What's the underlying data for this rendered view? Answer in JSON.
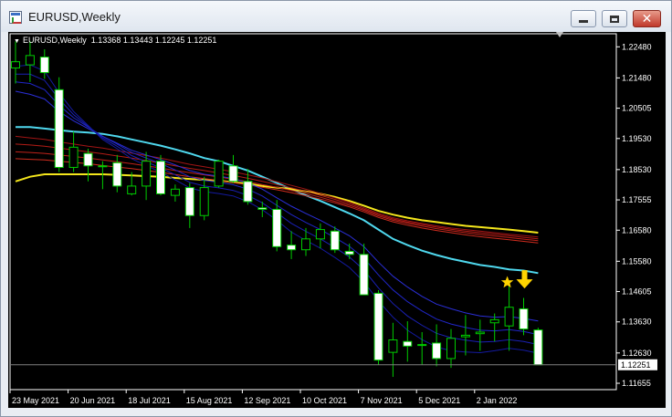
{
  "window": {
    "title": "EURUSD,Weekly",
    "minimize_icon": "minimize-icon",
    "maximize_icon": "maximize-icon",
    "close_icon": "close-icon"
  },
  "chart": {
    "symbol_line": "EURUSD,Weekly  1.13368 1.13443 1.12245 1.12251",
    "current_price_label": "1.12251",
    "colors": {
      "background": "#000000",
      "axis": "#ffffff",
      "bull": "#000000",
      "bear": "#ffffff",
      "wick": "#00cc00",
      "ema_blue": "#1e2bd6",
      "ema_red": "#c0221a",
      "ema_cyan": "#4fd8ee",
      "ema_yellow": "#f4e61c",
      "marker": "#ffd400"
    },
    "markers": [
      "star-icon",
      "arrow-down-icon"
    ]
  },
  "chart_data": {
    "type": "candlestick",
    "title": "EURUSD,Weekly",
    "ohlc_last": {
      "open": 1.13368,
      "high": 1.13443,
      "low": 1.12245,
      "close": 1.12251
    },
    "ylim": [
      1.1145,
      1.229
    ],
    "y_ticks": [
      "1.22480",
      "1.21480",
      "1.20505",
      "1.19530",
      "1.18530",
      "1.17555",
      "1.16580",
      "1.15580",
      "1.14605",
      "1.13630",
      "1.12630",
      "1.11655"
    ],
    "y_tick_values": [
      1.2248,
      1.2148,
      1.20505,
      1.1953,
      1.1853,
      1.17555,
      1.1658,
      1.1558,
      1.14605,
      1.1363,
      1.1263,
      1.11655
    ],
    "x_ticks": [
      "23 May 2021",
      "20 Jun 2021",
      "18 Jul 2021",
      "15 Aug 2021",
      "12 Sep 2021",
      "10 Oct 2021",
      "7 Nov 2021",
      "5 Dec 2021",
      "2 Jan 2022"
    ],
    "x_tick_index": [
      0,
      4,
      8,
      12,
      16,
      20,
      24,
      28,
      32
    ],
    "candles": [
      {
        "o": 1.218,
        "h": 1.2265,
        "l": 1.213,
        "c": 1.22
      },
      {
        "o": 1.219,
        "h": 1.2266,
        "l": 1.2135,
        "c": 1.222
      },
      {
        "o": 1.2215,
        "h": 1.224,
        "l": 1.2145,
        "c": 1.2165
      },
      {
        "o": 1.211,
        "h": 1.215,
        "l": 1.1845,
        "c": 1.186
      },
      {
        "o": 1.186,
        "h": 1.1975,
        "l": 1.1845,
        "c": 1.1925
      },
      {
        "o": 1.1905,
        "h": 1.192,
        "l": 1.1815,
        "c": 1.1865
      },
      {
        "o": 1.1865,
        "h": 1.188,
        "l": 1.179,
        "c": 1.1865
      },
      {
        "o": 1.1875,
        "h": 1.19,
        "l": 1.178,
        "c": 1.18
      },
      {
        "o": 1.1775,
        "h": 1.1845,
        "l": 1.177,
        "c": 1.18
      },
      {
        "o": 1.18,
        "h": 1.191,
        "l": 1.1755,
        "c": 1.188
      },
      {
        "o": 1.188,
        "h": 1.19,
        "l": 1.177,
        "c": 1.1775
      },
      {
        "o": 1.177,
        "h": 1.1805,
        "l": 1.175,
        "c": 1.179
      },
      {
        "o": 1.1795,
        "h": 1.181,
        "l": 1.1665,
        "c": 1.1705
      },
      {
        "o": 1.1705,
        "h": 1.183,
        "l": 1.169,
        "c": 1.1795
      },
      {
        "o": 1.18,
        "h": 1.1885,
        "l": 1.1795,
        "c": 1.188
      },
      {
        "o": 1.1865,
        "h": 1.19,
        "l": 1.181,
        "c": 1.1815
      },
      {
        "o": 1.1815,
        "h": 1.1855,
        "l": 1.174,
        "c": 1.175
      },
      {
        "o": 1.173,
        "h": 1.175,
        "l": 1.17,
        "c": 1.1725
      },
      {
        "o": 1.1725,
        "h": 1.1755,
        "l": 1.159,
        "c": 1.1605
      },
      {
        "o": 1.161,
        "h": 1.1655,
        "l": 1.1565,
        "c": 1.1595
      },
      {
        "o": 1.1595,
        "h": 1.1665,
        "l": 1.1575,
        "c": 1.163
      },
      {
        "o": 1.163,
        "h": 1.168,
        "l": 1.16,
        "c": 1.166
      },
      {
        "o": 1.1655,
        "h": 1.167,
        "l": 1.1585,
        "c": 1.1595
      },
      {
        "o": 1.159,
        "h": 1.1615,
        "l": 1.1565,
        "c": 1.158
      },
      {
        "o": 1.158,
        "h": 1.1615,
        "l": 1.145,
        "c": 1.145
      },
      {
        "o": 1.1455,
        "h": 1.1465,
        "l": 1.1225,
        "c": 1.124
      },
      {
        "o": 1.1265,
        "h": 1.136,
        "l": 1.1186,
        "c": 1.1305
      },
      {
        "o": 1.13,
        "h": 1.1365,
        "l": 1.1235,
        "c": 1.1285
      },
      {
        "o": 1.129,
        "h": 1.133,
        "l": 1.1225,
        "c": 1.129
      },
      {
        "o": 1.1295,
        "h": 1.1355,
        "l": 1.122,
        "c": 1.1245
      },
      {
        "o": 1.1245,
        "h": 1.134,
        "l": 1.1215,
        "c": 1.131
      },
      {
        "o": 1.1315,
        "h": 1.1385,
        "l": 1.1255,
        "c": 1.132
      },
      {
        "o": 1.1325,
        "h": 1.137,
        "l": 1.127,
        "c": 1.133
      },
      {
        "o": 1.136,
        "h": 1.139,
        "l": 1.13,
        "c": 1.137
      },
      {
        "o": 1.135,
        "h": 1.148,
        "l": 1.127,
        "c": 1.141
      },
      {
        "o": 1.1405,
        "h": 1.144,
        "l": 1.132,
        "c": 1.134
      },
      {
        "o": 1.1337,
        "h": 1.1344,
        "l": 1.1225,
        "c": 1.1225
      }
    ],
    "ema_lines": [
      {
        "color": "#4fd8ee",
        "width": 2,
        "values": [
          1.199,
          1.199,
          1.1985,
          1.198,
          1.1975,
          1.1972,
          1.1968,
          1.196,
          1.195,
          1.194,
          1.193,
          1.1918,
          1.1905,
          1.189,
          1.188,
          1.1865,
          1.185,
          1.183,
          1.181,
          1.179,
          1.177,
          1.1752,
          1.1732,
          1.1712,
          1.169,
          1.166,
          1.163,
          1.161,
          1.1592,
          1.1578,
          1.1566,
          1.1556,
          1.1546,
          1.154,
          1.1532,
          1.1528,
          1.152
        ]
      },
      {
        "color": "#f4e61c",
        "width": 2,
        "values": [
          1.1815,
          1.183,
          1.1838,
          1.1838,
          1.1838,
          1.1838,
          1.1838,
          1.1836,
          1.1834,
          1.1832,
          1.183,
          1.1826,
          1.1823,
          1.182,
          1.1818,
          1.1812,
          1.1808,
          1.18,
          1.1795,
          1.179,
          1.1783,
          1.1775,
          1.1765,
          1.1752,
          1.1737,
          1.172,
          1.1708,
          1.1698,
          1.169,
          1.1684,
          1.1678,
          1.1672,
          1.1668,
          1.1664,
          1.166,
          1.1655,
          1.165
        ]
      },
      {
        "color": "#a31515",
        "width": 1,
        "values": [
          1.196,
          1.1955,
          1.195,
          1.1942,
          1.1935,
          1.1928,
          1.1922,
          1.1914,
          1.1906,
          1.1898,
          1.189,
          1.188,
          1.187,
          1.1862,
          1.1854,
          1.1846,
          1.1836,
          1.1826,
          1.1814,
          1.1802,
          1.179,
          1.1776,
          1.1762,
          1.1748,
          1.173,
          1.1712,
          1.1698,
          1.1688,
          1.168,
          1.1672,
          1.1665,
          1.166,
          1.1655,
          1.165,
          1.1645,
          1.1641,
          1.1636
        ]
      },
      {
        "color": "#b41c16",
        "width": 1,
        "values": [
          1.1935,
          1.1932,
          1.1928,
          1.1922,
          1.1916,
          1.191,
          1.1904,
          1.1897,
          1.189,
          1.1882,
          1.1874,
          1.1865,
          1.1857,
          1.185,
          1.1842,
          1.1834,
          1.1825,
          1.1815,
          1.1805,
          1.1794,
          1.1783,
          1.177,
          1.1757,
          1.1743,
          1.1726,
          1.1708,
          1.1694,
          1.1684,
          1.1676,
          1.1668,
          1.1661,
          1.1655,
          1.165,
          1.1645,
          1.164,
          1.1635,
          1.163
        ]
      },
      {
        "color": "#c0221a",
        "width": 1,
        "values": [
          1.191,
          1.1908,
          1.1905,
          1.19,
          1.1895,
          1.189,
          1.1884,
          1.1878,
          1.1872,
          1.1865,
          1.1858,
          1.185,
          1.1843,
          1.1836,
          1.1829,
          1.1822,
          1.1814,
          1.1805,
          1.1796,
          1.1786,
          1.1776,
          1.1764,
          1.1751,
          1.1738,
          1.1722,
          1.1704,
          1.169,
          1.168,
          1.1671,
          1.1663,
          1.1656,
          1.165,
          1.1644,
          1.1639,
          1.1634,
          1.1629,
          1.1624
        ]
      },
      {
        "color": "#d02c1e",
        "width": 1,
        "values": [
          1.1888,
          1.1886,
          1.1884,
          1.188,
          1.1876,
          1.1872,
          1.1866,
          1.1861,
          1.1856,
          1.185,
          1.1844,
          1.1837,
          1.183,
          1.1824,
          1.1818,
          1.1811,
          1.1804,
          1.1796,
          1.1788,
          1.1779,
          1.1769,
          1.1758,
          1.1746,
          1.1733,
          1.1717,
          1.1699,
          1.1685,
          1.1674,
          1.1665,
          1.1657,
          1.165,
          1.1643,
          1.1637,
          1.1632,
          1.1627,
          1.1622,
          1.1617
        ]
      },
      {
        "color": "#2b2fd8",
        "width": 1,
        "values": [
          1.2105,
          1.2095,
          1.208,
          1.204,
          1.201,
          1.1985,
          1.196,
          1.1938,
          1.1915,
          1.19,
          1.1885,
          1.1868,
          1.185,
          1.1838,
          1.1832,
          1.1824,
          1.181,
          1.179,
          1.1762,
          1.1735,
          1.1712,
          1.169,
          1.1665,
          1.164,
          1.1605,
          1.1555,
          1.151,
          1.1475,
          1.1445,
          1.142,
          1.1405,
          1.1392,
          1.1382,
          1.1378,
          1.138,
          1.1374,
          1.1366
        ]
      },
      {
        "color": "#2026c8",
        "width": 1,
        "values": [
          1.2135,
          1.213,
          1.211,
          1.206,
          1.202,
          1.199,
          1.196,
          1.1935,
          1.1908,
          1.189,
          1.1872,
          1.1852,
          1.183,
          1.1818,
          1.1812,
          1.1804,
          1.179,
          1.1768,
          1.1738,
          1.1708,
          1.1683,
          1.166,
          1.1634,
          1.1606,
          1.1568,
          1.1514,
          1.1466,
          1.1428,
          1.1398,
          1.1372,
          1.1356,
          1.1345,
          1.1336,
          1.1334,
          1.1338,
          1.1332,
          1.1322
        ]
      },
      {
        "color": "#1a20b4",
        "width": 1,
        "values": [
          1.216,
          1.216,
          1.214,
          1.208,
          1.203,
          1.1992,
          1.1955,
          1.1928,
          1.1898,
          1.1878,
          1.1858,
          1.1836,
          1.1812,
          1.18,
          1.1794,
          1.1786,
          1.177,
          1.1746,
          1.1714,
          1.168,
          1.1654,
          1.163,
          1.1602,
          1.1572,
          1.153,
          1.1472,
          1.1422,
          1.1382,
          1.1352,
          1.1326,
          1.1312,
          1.1304,
          1.1298,
          1.13,
          1.1306,
          1.13,
          1.129
        ]
      },
      {
        "color": "#141aa0",
        "width": 1,
        "values": [
          1.2185,
          1.219,
          1.217,
          1.21,
          1.204,
          1.1995,
          1.195,
          1.192,
          1.1888,
          1.1866,
          1.1845,
          1.182,
          1.1794,
          1.1782,
          1.1776,
          1.1768,
          1.175,
          1.1724,
          1.169,
          1.1652,
          1.1625,
          1.16,
          1.157,
          1.1538,
          1.1492,
          1.143,
          1.1378,
          1.1336,
          1.1306,
          1.1282,
          1.127,
          1.1266,
          1.1264,
          1.127,
          1.1278,
          1.1272,
          1.1262
        ]
      }
    ]
  }
}
